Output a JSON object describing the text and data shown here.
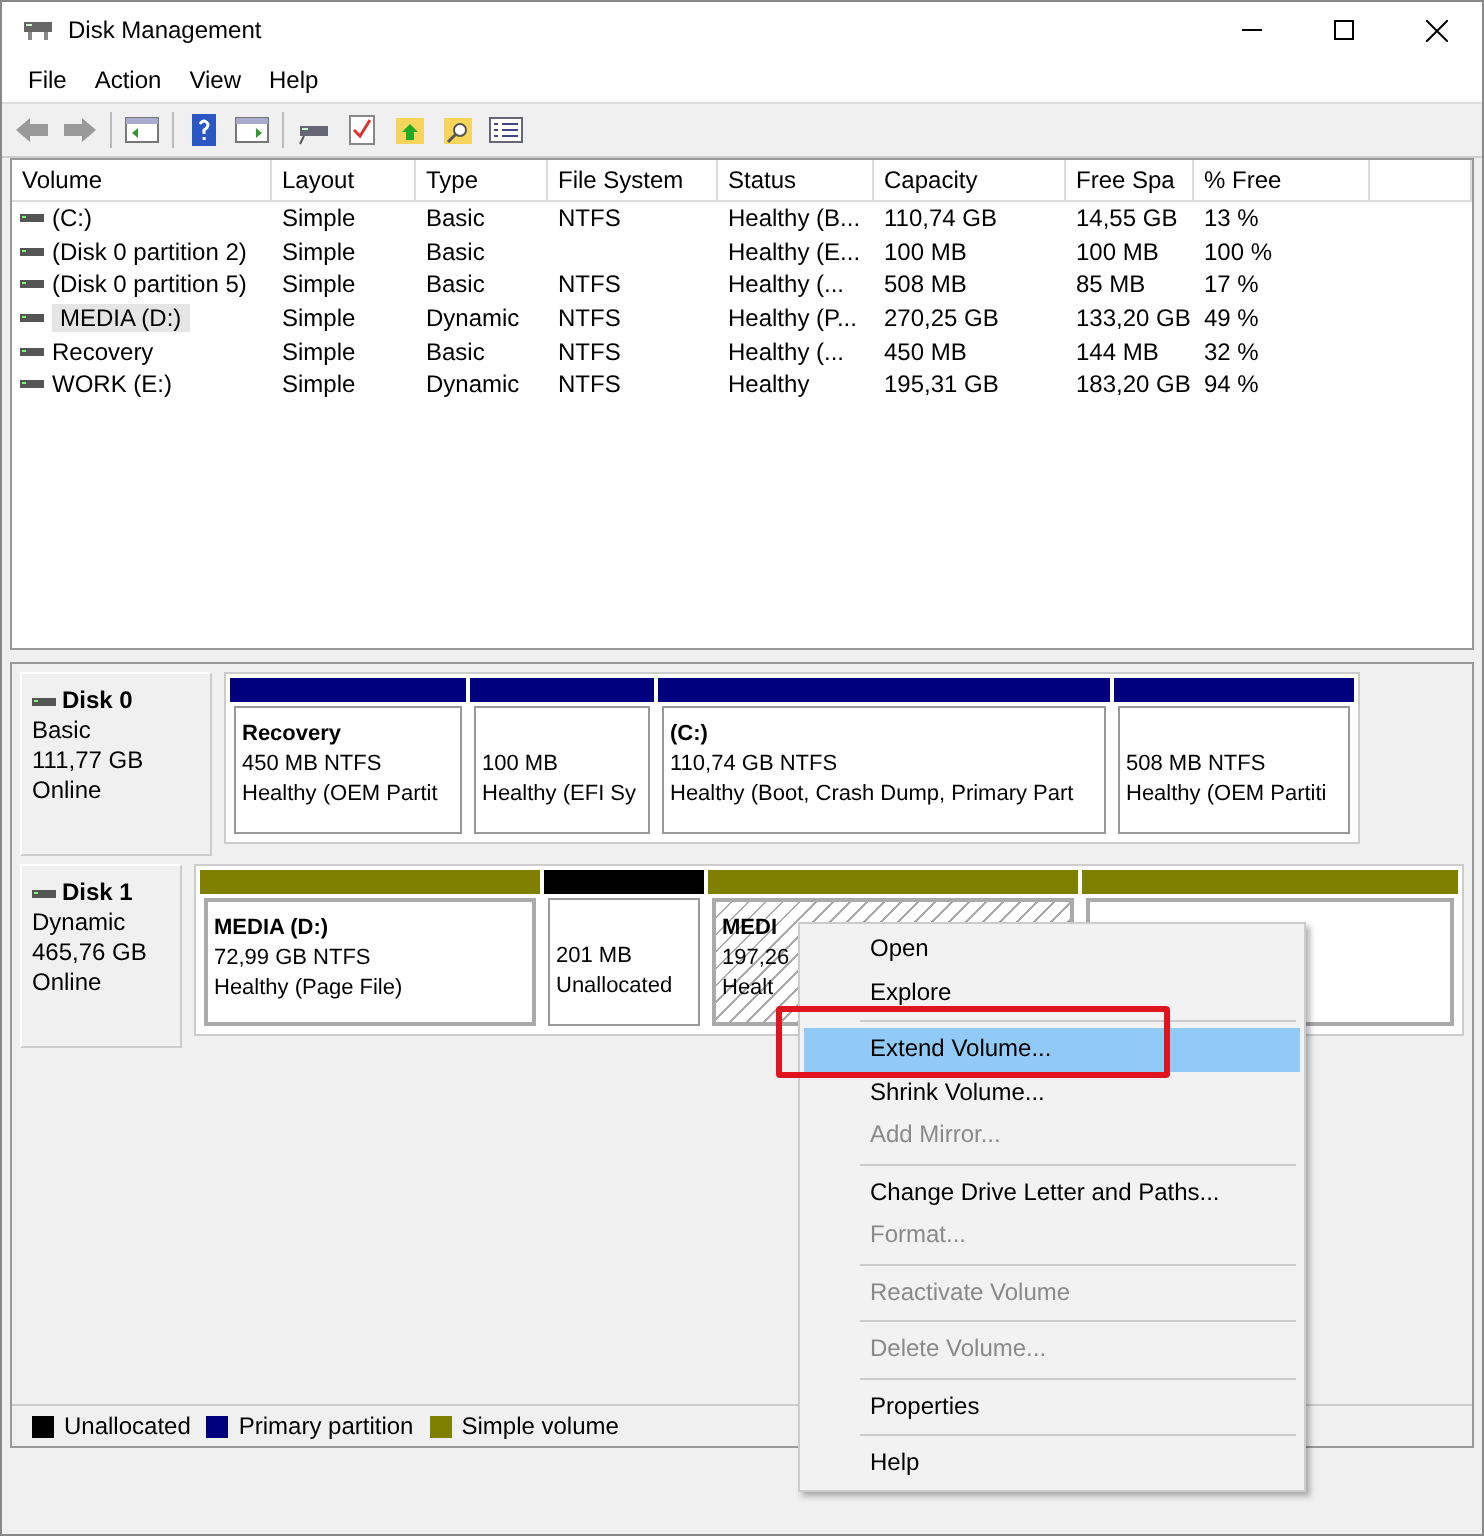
{
  "window": {
    "title": "Disk Management"
  },
  "menu_bar": [
    "File",
    "Action",
    "View",
    "Help"
  ],
  "volume_list": {
    "columns": [
      "Volume",
      "Layout",
      "Type",
      "File System",
      "Status",
      "Capacity",
      "Free Spa",
      "% Free"
    ],
    "rows": [
      {
        "cells": [
          "(C:)",
          "Simple",
          "Basic",
          "NTFS",
          "Healthy (B...",
          "110,74 GB",
          "14,55 GB",
          "13 %"
        ],
        "selected": false
      },
      {
        "cells": [
          "(Disk 0 partition 2)",
          "Simple",
          "Basic",
          "",
          "Healthy (E...",
          "100 MB",
          "100 MB",
          "100 %"
        ],
        "selected": false
      },
      {
        "cells": [
          "(Disk 0 partition 5)",
          "Simple",
          "Basic",
          "NTFS",
          "Healthy (...",
          "508 MB",
          "85 MB",
          "17 %"
        ],
        "selected": false
      },
      {
        "cells": [
          "MEDIA (D:)",
          "Simple",
          "Dynamic",
          "NTFS",
          "Healthy (P...",
          "270,25 GB",
          "133,20 GB",
          "49 %"
        ],
        "selected": true
      },
      {
        "cells": [
          "Recovery",
          "Simple",
          "Basic",
          "NTFS",
          "Healthy (...",
          "450 MB",
          "144 MB",
          "32 %"
        ],
        "selected": false
      },
      {
        "cells": [
          "WORK (E:)",
          "Simple",
          "Dynamic",
          "NTFS",
          "Healthy",
          "195,31 GB",
          "183,20 GB",
          "94 %"
        ],
        "selected": false
      }
    ]
  },
  "disks": [
    {
      "name": "Disk 0",
      "type": "Basic",
      "size": "111,77 GB",
      "status": "Online",
      "partitions": [
        {
          "kind": "primary",
          "name": "Recovery",
          "size": "450 MB NTFS",
          "status": "Healthy (OEM Partit",
          "selected": false
        },
        {
          "kind": "primary",
          "size": "100 MB",
          "status": "Healthy (EFI Sy",
          "selected": false
        },
        {
          "kind": "primary",
          "name": "(C:)",
          "size": "110,74 GB NTFS",
          "status": "Healthy (Boot, Crash Dump, Primary Part",
          "selected": false
        },
        {
          "kind": "primary",
          "size": "508 MB NTFS",
          "status": "Healthy (OEM Partiti",
          "selected": false
        }
      ]
    },
    {
      "name": "Disk 1",
      "type": "Dynamic",
      "size": "465,76 GB",
      "status": "Online",
      "partitions": [
        {
          "kind": "simple",
          "name": "MEDIA  (D:)",
          "size": "72,99 GB NTFS",
          "status": "Healthy (Page File)",
          "selected": false
        },
        {
          "kind": "unallocated",
          "size": "201 MB",
          "status": "Unallocated",
          "selected": false
        },
        {
          "kind": "simple",
          "name": "MEDI",
          "size": "197,26",
          "status": "Healt",
          "selected": true
        },
        {
          "kind": "simple",
          "selected": false
        }
      ]
    }
  ],
  "legend": [
    {
      "label": "Unallocated",
      "color": "#000000"
    },
    {
      "label": "Primary partition",
      "color": "#00007f"
    },
    {
      "label": "Simple volume",
      "color": "#7f7f00"
    }
  ],
  "context_menu": [
    {
      "kind": "item",
      "label": "Open",
      "disabled": false,
      "selected": false
    },
    {
      "kind": "item",
      "label": "Explore",
      "disabled": false,
      "selected": false
    },
    {
      "kind": "separator"
    },
    {
      "kind": "item",
      "label": "Extend Volume...",
      "disabled": false,
      "selected": true
    },
    {
      "kind": "item",
      "label": "Shrink Volume...",
      "disabled": false,
      "selected": false
    },
    {
      "kind": "item",
      "label": "Add Mirror...",
      "disabled": true,
      "selected": false
    },
    {
      "kind": "separator"
    },
    {
      "kind": "item",
      "label": "Change Drive Letter and Paths...",
      "disabled": false,
      "selected": false
    },
    {
      "kind": "item",
      "label": "Format...",
      "disabled": true,
      "selected": false
    },
    {
      "kind": "separator"
    },
    {
      "kind": "item",
      "label": "Reactivate Volume",
      "disabled": true,
      "selected": false
    },
    {
      "kind": "separator"
    },
    {
      "kind": "item",
      "label": "Delete Volume...",
      "disabled": true,
      "selected": false
    },
    {
      "kind": "separator"
    },
    {
      "kind": "item",
      "label": "Properties",
      "disabled": false,
      "selected": false
    },
    {
      "kind": "separator"
    },
    {
      "kind": "item",
      "label": "Help",
      "disabled": false,
      "selected": false
    }
  ]
}
